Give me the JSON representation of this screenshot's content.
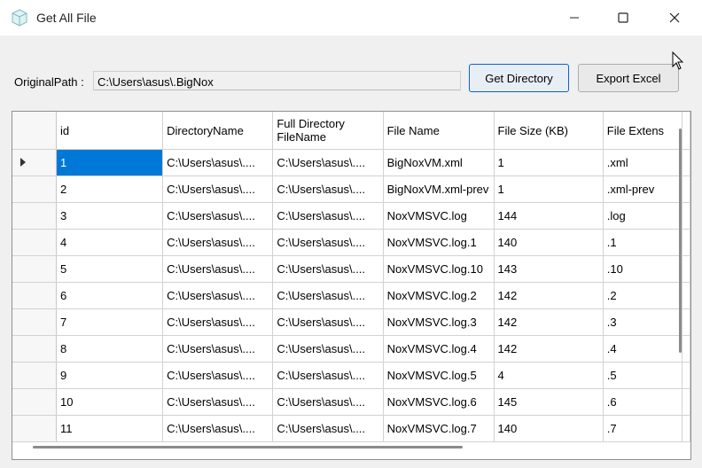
{
  "window": {
    "title": "Get All File",
    "minimize": "—",
    "maximize": "☐",
    "close": "✕"
  },
  "form": {
    "path_label": "OriginalPath :",
    "path_value": "C:\\Users\\asus\\.BigNox",
    "get_button": "Get  Directory",
    "export_button": "Export Excel"
  },
  "grid": {
    "columns": [
      "id",
      "DirectoryName",
      "Full Directory FileName",
      "File Name",
      "File Size (KB)",
      "File Extens"
    ],
    "rows": [
      [
        "1",
        "C:\\Users\\asus\\....",
        "C:\\Users\\asus\\....",
        "BigNoxVM.xml",
        "1",
        ".xml"
      ],
      [
        "2",
        "C:\\Users\\asus\\....",
        "C:\\Users\\asus\\....",
        "BigNoxVM.xml-prev",
        "1",
        ".xml-prev"
      ],
      [
        "3",
        "C:\\Users\\asus\\....",
        "C:\\Users\\asus\\....",
        "NoxVMSVC.log",
        "144",
        ".log"
      ],
      [
        "4",
        "C:\\Users\\asus\\....",
        "C:\\Users\\asus\\....",
        "NoxVMSVC.log.1",
        "140",
        ".1"
      ],
      [
        "5",
        "C:\\Users\\asus\\....",
        "C:\\Users\\asus\\....",
        "NoxVMSVC.log.10",
        "143",
        ".10"
      ],
      [
        "6",
        "C:\\Users\\asus\\....",
        "C:\\Users\\asus\\....",
        "NoxVMSVC.log.2",
        "142",
        ".2"
      ],
      [
        "7",
        "C:\\Users\\asus\\....",
        "C:\\Users\\asus\\....",
        "NoxVMSVC.log.3",
        "142",
        ".3"
      ],
      [
        "8",
        "C:\\Users\\asus\\....",
        "C:\\Users\\asus\\....",
        "NoxVMSVC.log.4",
        "142",
        ".4"
      ],
      [
        "9",
        "C:\\Users\\asus\\....",
        "C:\\Users\\asus\\....",
        "NoxVMSVC.log.5",
        "4",
        ".5"
      ],
      [
        "10",
        "C:\\Users\\asus\\....",
        "C:\\Users\\asus\\....",
        "NoxVMSVC.log.6",
        "145",
        ".6"
      ],
      [
        "11",
        "C:\\Users\\asus\\....",
        "C:\\Users\\asus\\....",
        "NoxVMSVC.log.7",
        "140",
        ".7"
      ]
    ],
    "selected_row": 0,
    "selected_color": "#0078d7"
  }
}
